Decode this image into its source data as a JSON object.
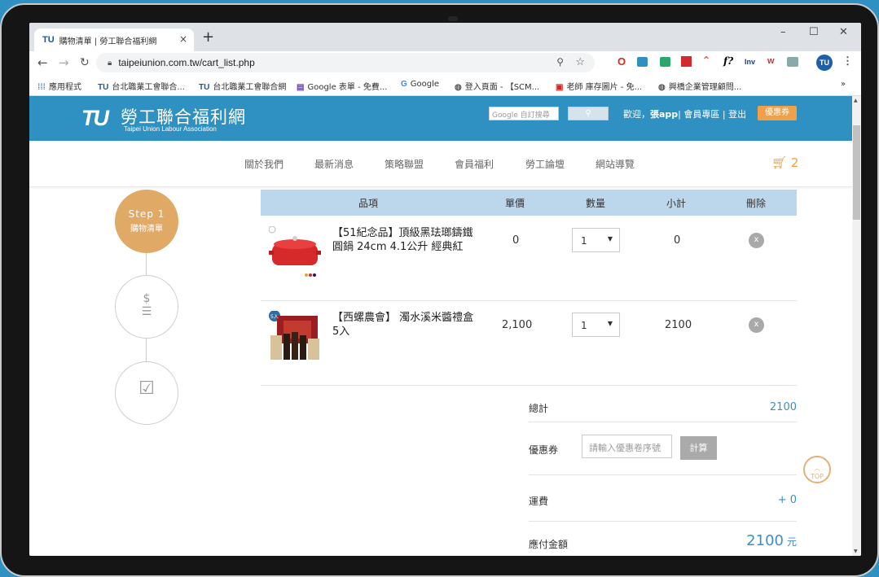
{
  "browser": {
    "tab_title": "購物清單 | 勞工聯合福利網",
    "tab_favicon": "TU",
    "tab_close": "×",
    "new_tab": "+",
    "url": "taipeiunion.com.tw/cart_list.php",
    "window_controls": [
      "–",
      "☐",
      "✕"
    ],
    "extensions": [
      "O",
      "f?",
      "Inv",
      "TU"
    ],
    "bookmarks": [
      {
        "icon": "apps-icon",
        "label": "應用程式"
      },
      {
        "icon": "TU",
        "label": "台北職業工會聯合..."
      },
      {
        "icon": "TU",
        "label": "台北職業工會聯合網"
      },
      {
        "icon": "forms-icon",
        "label": "Google 表單 - 免費..."
      },
      {
        "icon": "G",
        "label": "Google"
      },
      {
        "icon": "globe-icon",
        "label": "登入頁面 - 【SCM..."
      },
      {
        "icon": "image-icon",
        "label": "老師 庫存圖片 - 免..."
      },
      {
        "icon": "globe-icon",
        "label": "興橋企業管理顧問..."
      }
    ],
    "bookmarks_more": "»"
  },
  "site": {
    "logo_tu": "TU",
    "logo_name": "勞工聯合福利網",
    "logo_en": "Taipei Union Labour Association",
    "search_placeholder": "Google 自訂搜尋",
    "welcome_prefix": "歡迎，",
    "username": "張app",
    "links": "| 會員專區 | 登出",
    "coupon_button": "優惠券",
    "nav": [
      "關於我們",
      "最新消息",
      "策略聯盟",
      "會員福利",
      "勞工論壇",
      "網站導覽"
    ],
    "cart_count": "2"
  },
  "steps": {
    "step1_title": "Step 1",
    "step1_label": "購物清單"
  },
  "table": {
    "headers": [
      "品項",
      "單價",
      "數量",
      "小計",
      "刪除"
    ],
    "rows": [
      {
        "name": "【51紀念品】頂級黑珐瑯鑄鐵圓鍋 24cm 4.1公升 經典紅",
        "price": "0",
        "qty": "1",
        "subtotal": "0"
      },
      {
        "name": "【西螺農會】 濁水溪米醬禮盒 5入",
        "price": "2,100",
        "qty": "1",
        "subtotal": "2100",
        "badge": "5入"
      }
    ]
  },
  "totals": {
    "total_label": "總計",
    "total_value": "2100",
    "coupon_label": "優惠券",
    "coupon_placeholder": "請輸入優惠卷序號",
    "calc_button": "計算",
    "shipping_label": "運費",
    "shipping_value": "+ 0",
    "payable_label": "應付金額",
    "payable_value": "2100",
    "payable_unit": "元"
  },
  "top_button": "TOP",
  "colors": {
    "header": "#2f90c2",
    "accent": "#f0a046",
    "step_active": "#e0a965",
    "table_head": "#bcd6ec"
  }
}
